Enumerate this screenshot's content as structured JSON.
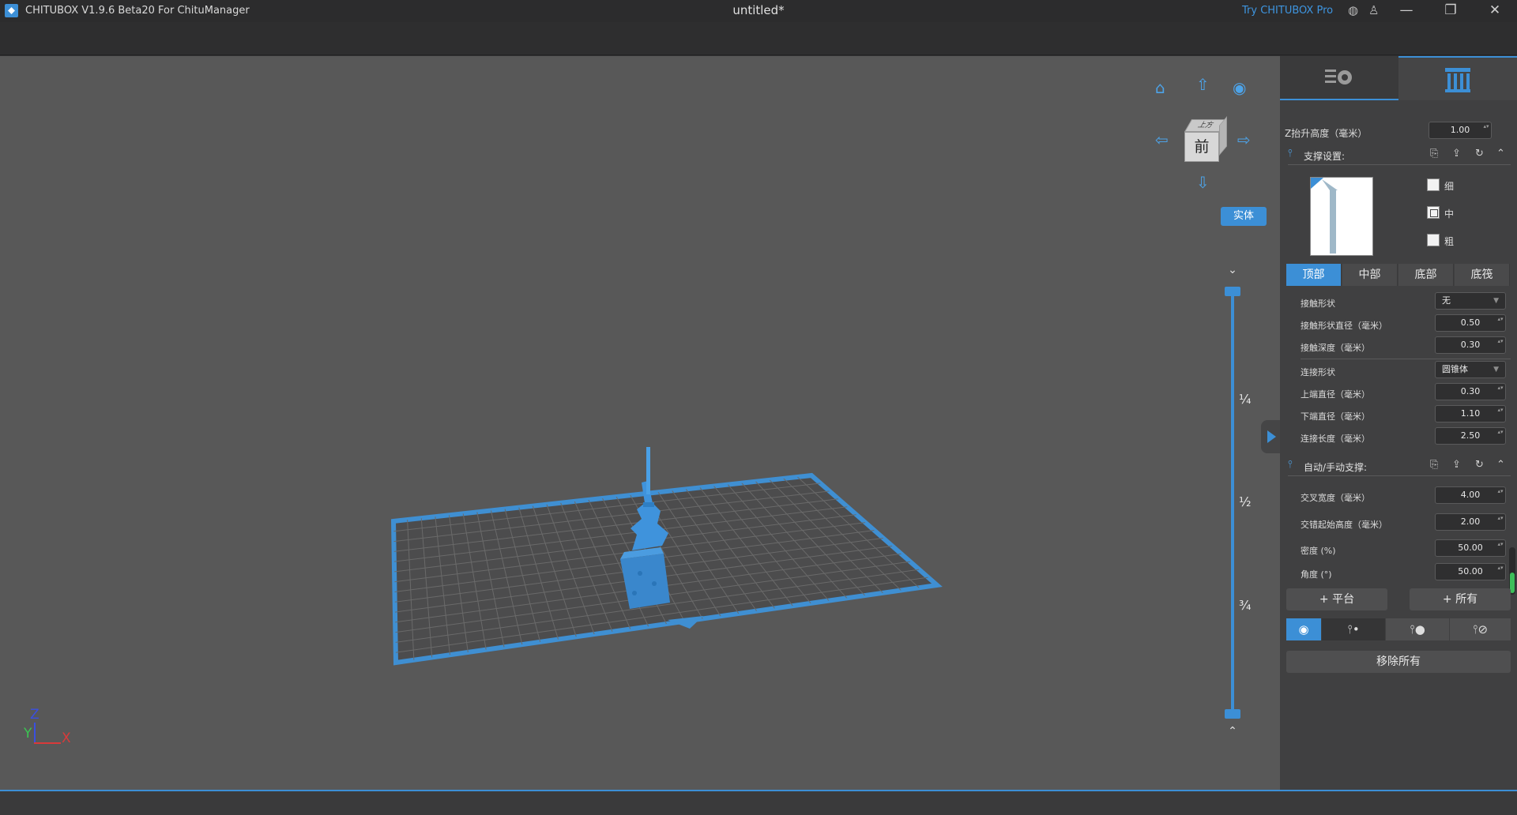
{
  "app": {
    "name": "CHITUBOX V1.9.6 Beta20 For ChituManager",
    "document_title": "untitled*",
    "try_pro": "Try CHITUBOX Pro",
    "accent": "#3c8fd6"
  },
  "window_controls": {
    "minimize": "—",
    "restore": "❐",
    "close": "✕"
  },
  "viewport": {
    "view_cube_front": "前",
    "view_cube_top": "上方",
    "render_mode": "实体",
    "layer_marks": [
      "¼",
      "½",
      "¾"
    ],
    "axes": {
      "z": "Z",
      "y": "Y",
      "x": "X"
    }
  },
  "panel": {
    "z_lift_label": "Z抬升高度（毫米）",
    "z_lift_value": "1.00",
    "support_settings": {
      "title": "支撑设置:",
      "densities": [
        {
          "label": "细",
          "checked": false
        },
        {
          "label": "中",
          "checked": true
        },
        {
          "label": "粗",
          "checked": false
        }
      ],
      "part_tabs": [
        "顶部",
        "中部",
        "底部",
        "底筏"
      ],
      "active_part_tab": 0,
      "fields": [
        {
          "label": "接触形状",
          "value": "无",
          "kind": "select"
        },
        {
          "label": "接触形状直径（毫米）",
          "value": "0.50",
          "kind": "number"
        },
        {
          "label": "接触深度（毫米）",
          "value": "0.30",
          "kind": "number"
        },
        {
          "label": "连接形状",
          "value": "圆锥体",
          "kind": "select"
        },
        {
          "label": "上端直径（毫米）",
          "value": "0.30",
          "kind": "number"
        },
        {
          "label": "下端直径（毫米）",
          "value": "1.10",
          "kind": "number"
        },
        {
          "label": "连接长度（毫米）",
          "value": "2.50",
          "kind": "number"
        }
      ]
    },
    "auto_manual": {
      "title": "自动/手动支撑:",
      "fields": [
        {
          "label": "交叉宽度（毫米）",
          "value": "4.00"
        },
        {
          "label": "交错起始高度（毫米）",
          "value": "2.00"
        },
        {
          "label": "密度 (%)",
          "value": "50.00"
        },
        {
          "label": "角度 (°)",
          "value": "50.00"
        }
      ]
    },
    "buttons": {
      "platform": "+ 平台",
      "all": "+ 所有",
      "remove_all": "移除所有"
    }
  }
}
